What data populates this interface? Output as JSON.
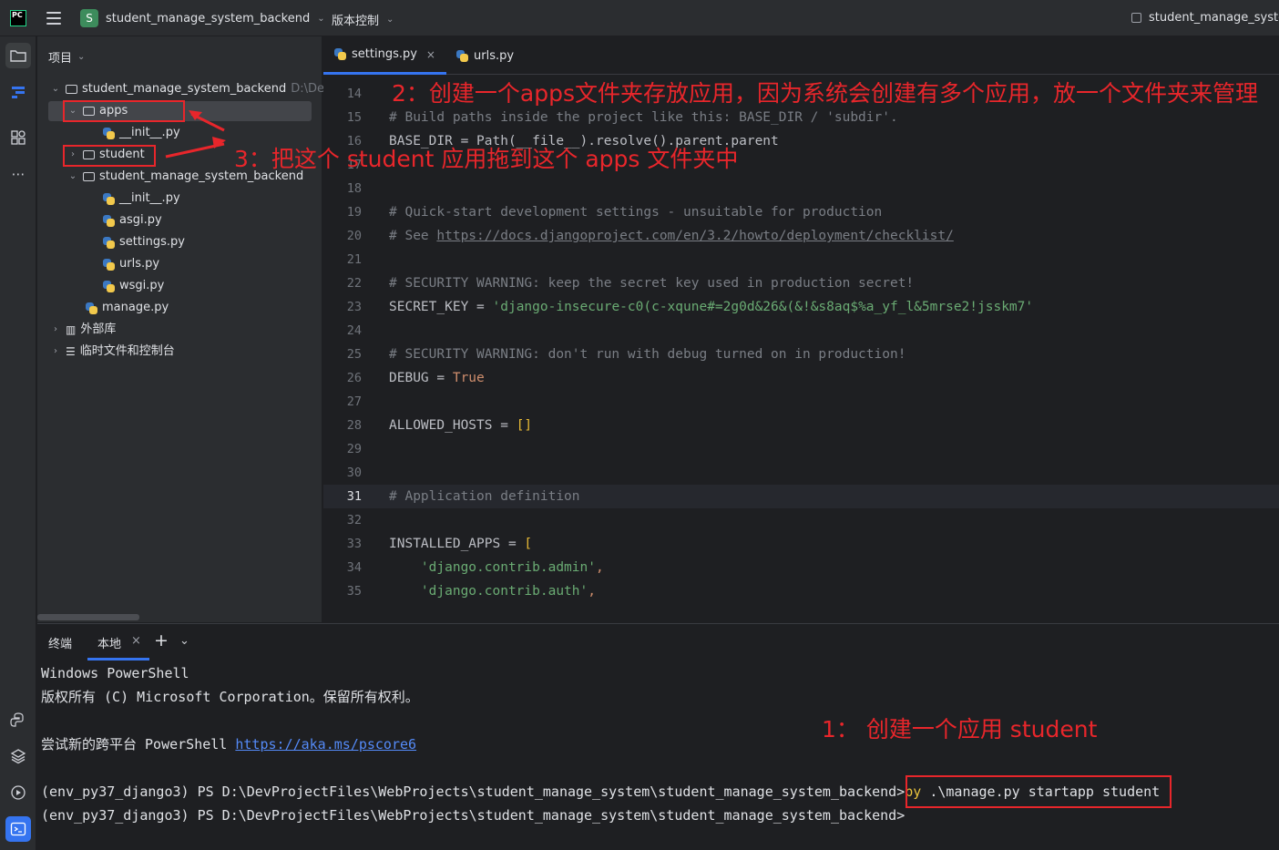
{
  "titlebar": {
    "logo": "PC",
    "project_initial": "S",
    "project_name": "student_manage_system_backend",
    "vcs_label": "版本控制",
    "right_project": "student_manage_syste"
  },
  "left_strip": {
    "icons": [
      "folder-icon",
      "structure-icon",
      "plugins-icon",
      "more-icon",
      "python-console-icon",
      "layers-icon",
      "run-icon",
      "terminal-icon"
    ]
  },
  "project_panel": {
    "header": "项目",
    "root_name": "student_manage_system_backend",
    "root_path": "D:\\Dev",
    "items": [
      {
        "label": "apps"
      },
      {
        "label": "__init__.py"
      },
      {
        "label": "student"
      },
      {
        "label": "student_manage_system_backend"
      },
      {
        "label": "__init__.py"
      },
      {
        "label": "asgi.py"
      },
      {
        "label": "settings.py"
      },
      {
        "label": "urls.py"
      },
      {
        "label": "wsgi.py"
      },
      {
        "label": "manage.py"
      },
      {
        "label": "外部库"
      },
      {
        "label": "临时文件和控制台"
      }
    ]
  },
  "editor": {
    "tabs": [
      {
        "label": "settings.py",
        "close": "×"
      },
      {
        "label": "urls.py"
      }
    ],
    "lines": [
      {
        "n": "14",
        "parts": [
          {
            "t": "",
            "c": "c-txt"
          }
        ]
      },
      {
        "n": "15",
        "parts": [
          {
            "t": "# Build paths inside the project like this: BASE_DIR / 'subdir'.",
            "c": "c-com"
          }
        ]
      },
      {
        "n": "16",
        "parts": [
          {
            "t": "BASE_DIR = Path(__file__).resolve().parent.parent",
            "c": "c-txt"
          }
        ]
      },
      {
        "n": "17",
        "parts": [
          {
            "t": "",
            "c": "c-txt"
          }
        ]
      },
      {
        "n": "18",
        "parts": [
          {
            "t": "",
            "c": "c-txt"
          }
        ]
      },
      {
        "n": "19",
        "parts": [
          {
            "t": "# Quick-start development settings - unsuitable for production",
            "c": "c-com"
          }
        ]
      },
      {
        "n": "20",
        "parts": [
          {
            "t": "# See ",
            "c": "c-com"
          },
          {
            "t": "https://docs.djangoproject.com/en/3.2/howto/deployment/checklist/",
            "c": "c-link"
          }
        ]
      },
      {
        "n": "21",
        "parts": [
          {
            "t": "",
            "c": "c-txt"
          }
        ]
      },
      {
        "n": "22",
        "parts": [
          {
            "t": "# SECURITY WARNING: keep the secret key used in production secret!",
            "c": "c-com"
          }
        ]
      },
      {
        "n": "23",
        "parts": [
          {
            "t": "SECRET_KEY = ",
            "c": "c-txt"
          },
          {
            "t": "'django-insecure-c0(c-xqune#=2g0d&26&(&!&s8aq$%a_yf_l&5mrse2!jsskm7'",
            "c": "c-str"
          }
        ]
      },
      {
        "n": "24",
        "parts": [
          {
            "t": "",
            "c": "c-txt"
          }
        ]
      },
      {
        "n": "25",
        "parts": [
          {
            "t": "# SECURITY WARNING: don't run with debug turned on in production!",
            "c": "c-com"
          }
        ]
      },
      {
        "n": "26",
        "parts": [
          {
            "t": "DEBUG = ",
            "c": "c-txt"
          },
          {
            "t": "True",
            "c": "c-kw"
          }
        ]
      },
      {
        "n": "27",
        "parts": [
          {
            "t": "",
            "c": "c-txt"
          }
        ]
      },
      {
        "n": "28",
        "parts": [
          {
            "t": "ALLOWED_HOSTS = ",
            "c": "c-txt"
          },
          {
            "t": "[]",
            "c": "c-br"
          }
        ]
      },
      {
        "n": "29",
        "parts": [
          {
            "t": "",
            "c": "c-txt"
          }
        ]
      },
      {
        "n": "30",
        "parts": [
          {
            "t": "",
            "c": "c-txt"
          }
        ]
      },
      {
        "n": "31",
        "parts": [
          {
            "t": "# Application definition",
            "c": "c-com"
          }
        ],
        "current": true
      },
      {
        "n": "32",
        "parts": [
          {
            "t": "",
            "c": "c-txt"
          }
        ]
      },
      {
        "n": "33",
        "parts": [
          {
            "t": "INSTALLED_APPS = ",
            "c": "c-txt"
          },
          {
            "t": "[",
            "c": "c-br"
          }
        ]
      },
      {
        "n": "34",
        "parts": [
          {
            "t": "    ",
            "c": "c-txt"
          },
          {
            "t": "'django.contrib.admin'",
            "c": "c-str"
          },
          {
            "t": ",",
            "c": "c-kw"
          }
        ]
      },
      {
        "n": "35",
        "parts": [
          {
            "t": "    ",
            "c": "c-txt"
          },
          {
            "t": "'django.contrib.auth'",
            "c": "c-str"
          },
          {
            "t": ",",
            "c": "c-kw"
          }
        ]
      }
    ]
  },
  "terminal": {
    "tab_terminal": "终端",
    "tab_local": "本地",
    "tab_close": "×",
    "add": "+",
    "lines": {
      "l1": "Windows PowerShell",
      "l2": "版权所有 (C) Microsoft Corporation。保留所有权利。",
      "l3_prefix": "尝试新的跨平台 PowerShell ",
      "l3_link": "https://aka.ms/pscore6",
      "prompt": "(env_py37_django3) PS D:\\DevProjectFiles\\WebProjects\\student_manage_system\\student_manage_system_backend>",
      "cmd_py": "py",
      "cmd_rest": " .\\manage.py startapp student"
    }
  },
  "annotations": {
    "step1": "1：  创建一个应用 student",
    "step2": "2：创建一个apps文件夹存放应用，因为系统会创建有多个应用，放一个文件夹来管理",
    "step3": "3：把这个 student 应用拖到这个 apps 文件夹中",
    "color": "#e8262b"
  }
}
